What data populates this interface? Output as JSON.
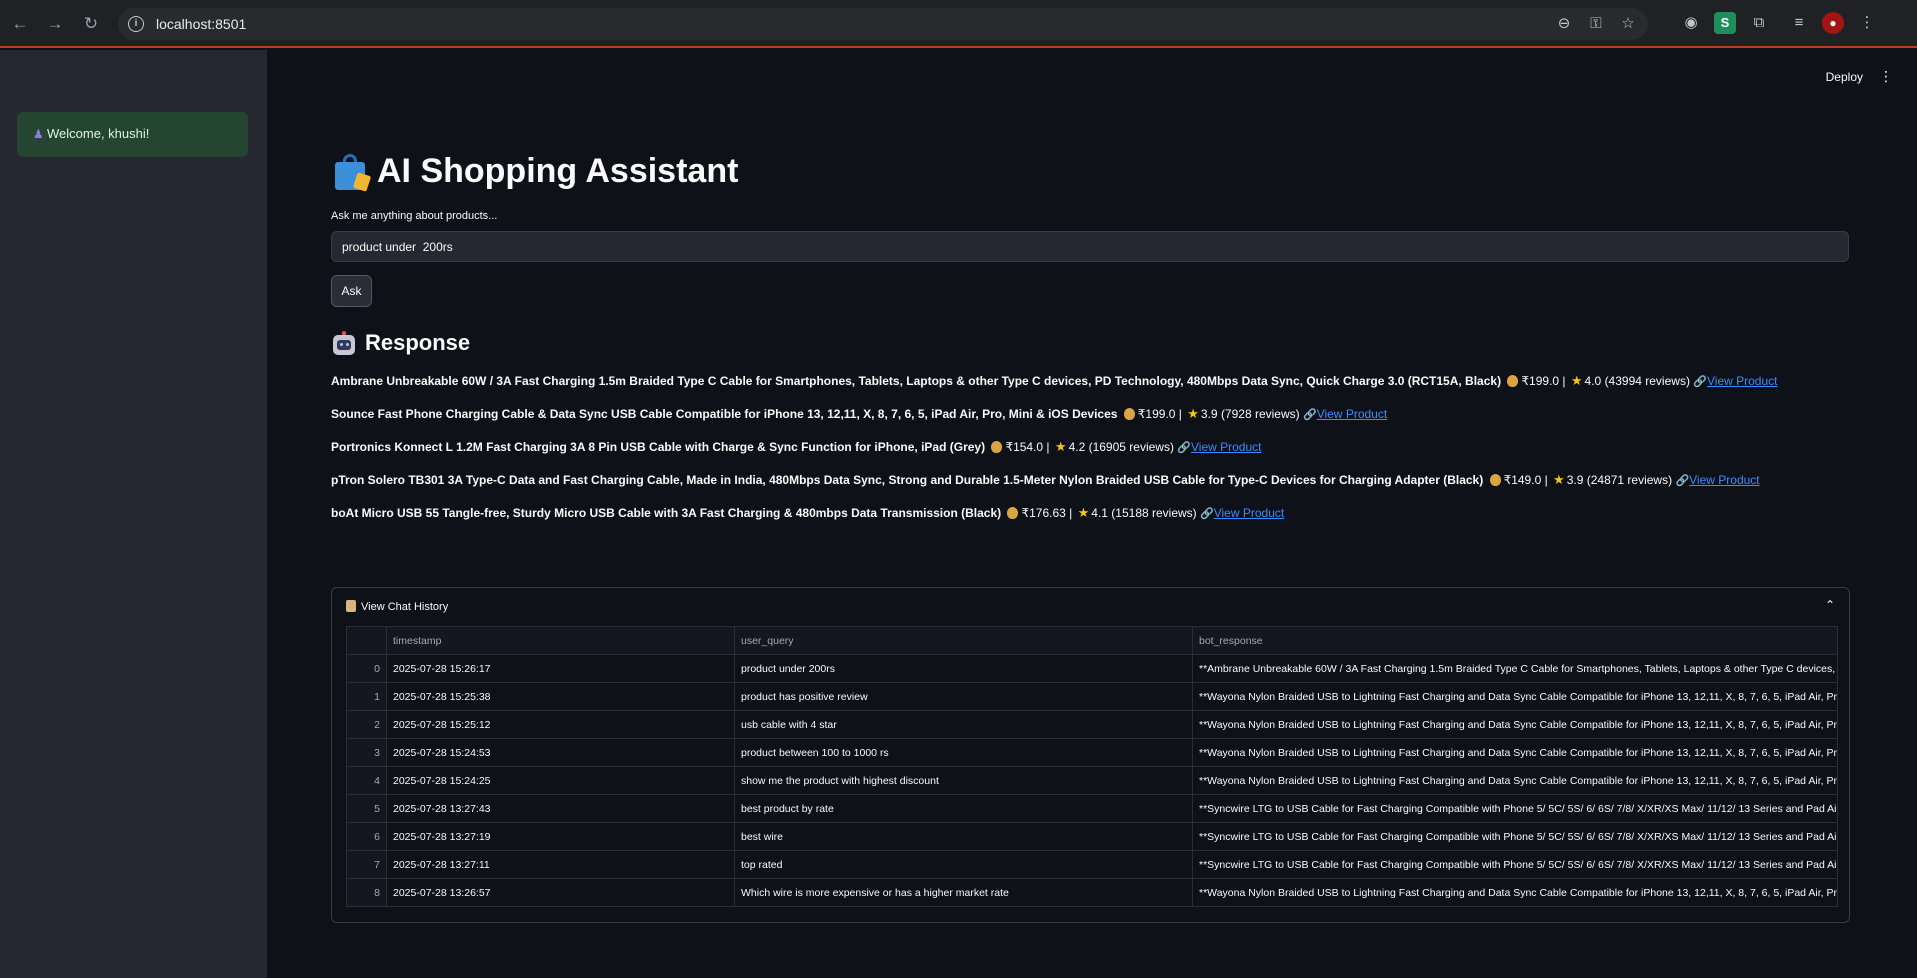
{
  "browser": {
    "url": "localhost:8501"
  },
  "sidebar": {
    "welcome": "Welcome, khushi!"
  },
  "header": {
    "deploy": "Deploy"
  },
  "app": {
    "title": "AI Shopping Assistant",
    "input_label": "Ask me anything about products...",
    "input_value": "product under  200rs",
    "ask_button": "Ask",
    "response_title": "Response"
  },
  "products": [
    {
      "name": "Ambrane Unbreakable 60W / 3A Fast Charging 1.5m Braided Type C Cable for Smartphones, Tablets, Laptops & other Type C devices, PD Technology, 480Mbps Data Sync, Quick Charge 3.0 (RCT15A, Black)",
      "price": "₹199.0 |",
      "rating": "4.0 (43994 reviews)",
      "link": "View Product"
    },
    {
      "name": "Sounce Fast Phone Charging Cable & Data Sync USB Cable Compatible for iPhone 13, 12,11, X, 8, 7, 6, 5, iPad Air, Pro, Mini & iOS Devices",
      "price": "₹199.0 |",
      "rating": "3.9 (7928 reviews)",
      "link": "View Product"
    },
    {
      "name": "Portronics Konnect L 1.2M Fast Charging 3A 8 Pin USB Cable with Charge & Sync Function for iPhone, iPad (Grey)",
      "price": "₹154.0 |",
      "rating": "4.2 (16905 reviews)",
      "link": "View Product"
    },
    {
      "name": "pTron Solero TB301 3A Type-C Data and Fast Charging Cable, Made in India, 480Mbps Data Sync, Strong and Durable 1.5-Meter Nylon Braided USB Cable for Type-C Devices for Charging Adapter (Black)",
      "price": "₹149.0 |",
      "rating": "3.9 (24871 reviews)",
      "link": "View Product"
    },
    {
      "name": "boAt Micro USB 55 Tangle-free, Sturdy Micro USB Cable with 3A Fast Charging & 480mbps Data Transmission (Black)",
      "price": "₹176.63 |",
      "rating": "4.1 (15188 reviews)",
      "link": "View Product"
    }
  ],
  "history": {
    "label": "View Chat History",
    "columns": [
      "timestamp",
      "user_query",
      "bot_response"
    ],
    "rows": [
      {
        "idx": "0",
        "timestamp": "2025-07-28 15:26:17",
        "user_query": "product under  200rs",
        "bot_response": "**Ambrane Unbreakable 60W / 3A Fast Charging 1.5m Braided Type C Cable for Smartphones, Tablets, Laptops & other Type C devices, PD"
      },
      {
        "idx": "1",
        "timestamp": "2025-07-28 15:25:38",
        "user_query": "product has positive  review",
        "bot_response": "**Wayona Nylon Braided USB to Lightning Fast Charging and Data Sync Cable Compatible for iPhone 13, 12,11, X, 8, 7, 6, 5, iPad Air, Pro, M"
      },
      {
        "idx": "2",
        "timestamp": "2025-07-28 15:25:12",
        "user_query": "usb cable with 4 star",
        "bot_response": "**Wayona Nylon Braided USB to Lightning Fast Charging and Data Sync Cable Compatible for iPhone 13, 12,11, X, 8, 7, 6, 5, iPad Air, Pro, M"
      },
      {
        "idx": "3",
        "timestamp": "2025-07-28 15:24:53",
        "user_query": "product between 100 to 1000 rs",
        "bot_response": "**Wayona Nylon Braided USB to Lightning Fast Charging and Data Sync Cable Compatible for iPhone 13, 12,11, X, 8, 7, 6, 5, iPad Air, Pro, M"
      },
      {
        "idx": "4",
        "timestamp": "2025-07-28 15:24:25",
        "user_query": "show me the product with highest discount",
        "bot_response": "**Wayona Nylon Braided USB to Lightning Fast Charging and Data Sync Cable Compatible for iPhone 13, 12,11, X, 8, 7, 6, 5, iPad Air, Pro, M"
      },
      {
        "idx": "5",
        "timestamp": "2025-07-28 13:27:43",
        "user_query": "best product by rate",
        "bot_response": "**Syncwire LTG to USB Cable for Fast Charging Compatible with Phone 5/ 5C/ 5S/ 6/ 6S/ 7/8/ X/XR/XS Max/ 11/12/ 13 Series and Pad Air/Mi"
      },
      {
        "idx": "6",
        "timestamp": "2025-07-28 13:27:19",
        "user_query": "best wire",
        "bot_response": "**Syncwire LTG to USB Cable for Fast Charging Compatible with Phone 5/ 5C/ 5S/ 6/ 6S/ 7/8/ X/XR/XS Max/ 11/12/ 13 Series and Pad Air/Mi"
      },
      {
        "idx": "7",
        "timestamp": "2025-07-28 13:27:11",
        "user_query": "top rated",
        "bot_response": "**Syncwire LTG to USB Cable for Fast Charging Compatible with Phone 5/ 5C/ 5S/ 6/ 6S/ 7/8/ X/XR/XS Max/ 11/12/ 13 Series and Pad Air/Mi"
      },
      {
        "idx": "8",
        "timestamp": "2025-07-28 13:26:57",
        "user_query": "Which wire is more expensive or has a higher market rate",
        "bot_response": "**Wayona Nylon Braided USB to Lightning Fast Charging and Data Sync Cable Compatible for iPhone 13, 12,11, X, 8, 7, 6, 5, iPad Air, Pro, M"
      }
    ]
  }
}
